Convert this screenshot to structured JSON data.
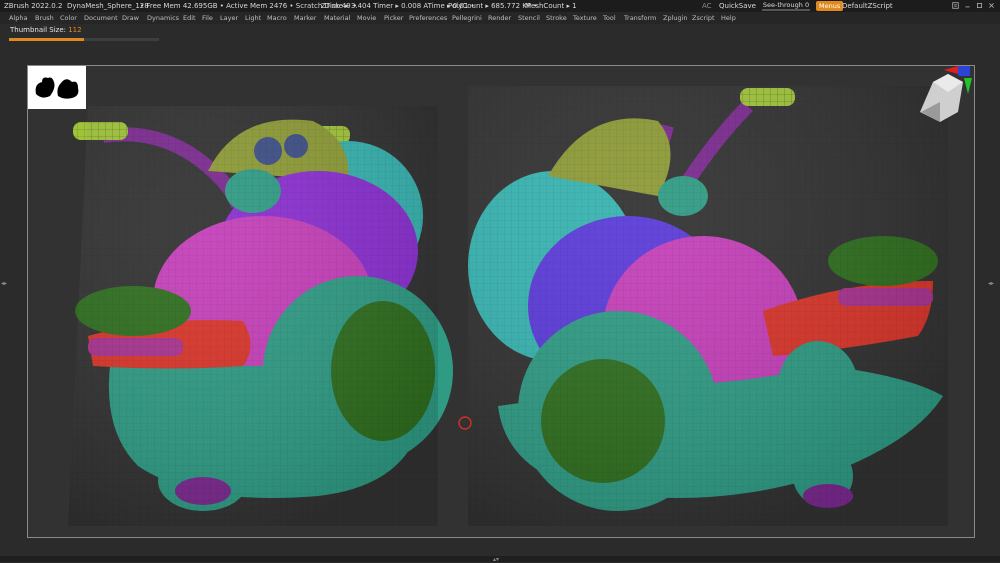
{
  "titlebar": {
    "app": "ZBrush 2022.0.2",
    "document": "DynaMesh_Sphere_128",
    "stats": "• Free Mem 42.695GB • Active Mem 2476 • Scratch Disk 49 •",
    "ztime": "ZTime ▸ 3.404 Timer ▸ 0.008 ATime ▸ 0.01 •",
    "polycount": "PolyCount ▸ 685.772 KP •",
    "meshcount": "MeshCount ▸ 1",
    "ac": "AC",
    "quicksave": "QuickSave",
    "seethrough_label": "See-through",
    "seethrough_value": "0",
    "seethrough_level": 0.0,
    "menus": "Menus",
    "script": "DefaultZScript"
  },
  "menu": [
    "Alpha",
    "Brush",
    "Color",
    "Document",
    "Draw",
    "Dynamics",
    "Edit",
    "File",
    "Layer",
    "Light",
    "Macro",
    "Marker",
    "Material",
    "Movie",
    "Picker",
    "Preferences",
    "Pellegrini",
    "Render",
    "Stencil",
    "Stroke",
    "Texture",
    "Tool",
    "Transform",
    "Zplugin",
    "Zscript",
    "Help"
  ],
  "thumbnail_size": {
    "label": "Thumbnail Size:",
    "value": "112",
    "level": 0.5
  },
  "colors": {
    "accent": "#e08a1e",
    "mesh_teal": "#2f9b84",
    "mesh_purple": "#8a2fd0",
    "mesh_magenta": "#c43fb8",
    "mesh_cyan": "#37b3b0",
    "mesh_green": "#2f6e1f",
    "mesh_red": "#d8352a",
    "mesh_olive": "#8d9a36",
    "mesh_lime": "#9fc43a"
  },
  "icons": {
    "thumbnail": "snail-silhouette-thumbnail",
    "gizmo": "head-orientation-gizmo",
    "cursor": "brush-cursor-ring"
  }
}
